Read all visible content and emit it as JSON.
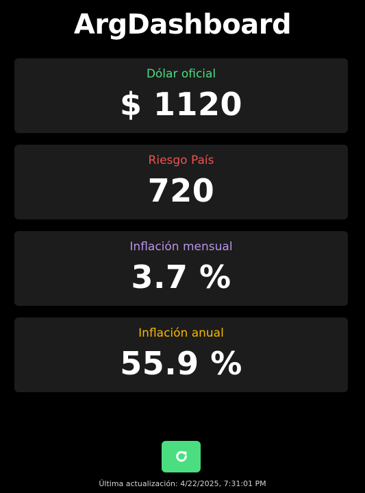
{
  "app": {
    "title": "ArgDashboard"
  },
  "cards": [
    {
      "label": "Dólar oficial",
      "value": "$ 1120",
      "label_color": "#4ade80"
    },
    {
      "label": "Riesgo País",
      "value": "720",
      "label_color": "#f05252"
    },
    {
      "label": "Inflación mensual",
      "value": "3.7 %",
      "label_color": "#b794e8"
    },
    {
      "label": "Inflación anual",
      "value": "55.9 %",
      "label_color": "#f5b800"
    }
  ],
  "refresh": {
    "icon": "refresh-icon",
    "background": "#4ade80"
  },
  "footer": {
    "last_update": "Última actualización: 4/22/2025, 7:31:01 PM"
  }
}
